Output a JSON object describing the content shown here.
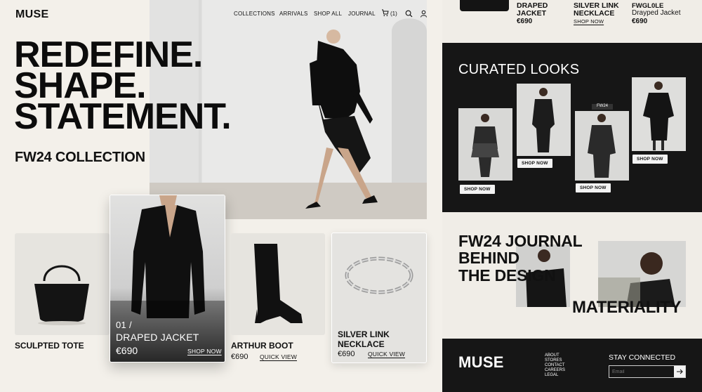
{
  "brand": "MUSE",
  "nav": {
    "items": [
      "COLLECTIONS",
      "ARRIVALS",
      "SHOP ALL",
      "JOURNAL"
    ],
    "cart_count": "(1)"
  },
  "hero": {
    "lines": [
      "REDEFINE.",
      "SHAPE.",
      "STATEMENT."
    ],
    "collection": "FW24 COLLECTION"
  },
  "products": {
    "tote": {
      "name": "SCULPTED TOTE"
    },
    "jacket": {
      "index": "01 /",
      "name": "DRAPED JACKET",
      "price": "€690",
      "cta": "SHOP NOW"
    },
    "boot": {
      "name": "ARTHUR BOOT",
      "price": "€690",
      "cta": "QUICK VIEW"
    },
    "necklace": {
      "name_line1": "SILVER LINK",
      "name_line2": "NECKLACE",
      "price": "€690",
      "cta": "QUICK VIEW"
    }
  },
  "right_top": {
    "item1": {
      "line1": "DRAPED",
      "line2": "JACKET",
      "price": "€690"
    },
    "item2": {
      "line1": "SILVER LINK",
      "line2": "NECKLACE",
      "cta": "SHOP NOW"
    },
    "item3": {
      "line1": "FWGL0LE",
      "line2": "Drayped Jacket",
      "price": "€690"
    }
  },
  "curated": {
    "title": "CURATED LOOKS",
    "badge": "FW24",
    "cta": "SHOP NOW"
  },
  "journal": {
    "line1": "FW24 JOURNAL",
    "line2": "BEHIND",
    "line3": "THE DESIGN",
    "overlay": "MATERIALITY"
  },
  "footer": {
    "brand": "MUSE",
    "links": [
      "ABOUT",
      "STORES",
      "CONTACT",
      "CAREERS",
      "LEGAL"
    ],
    "stay": "STAY CONNECTED",
    "email_placeholder": "Email"
  },
  "colors": {
    "bg": "#f3f0ea",
    "dark": "#161616",
    "text": "#111111"
  }
}
